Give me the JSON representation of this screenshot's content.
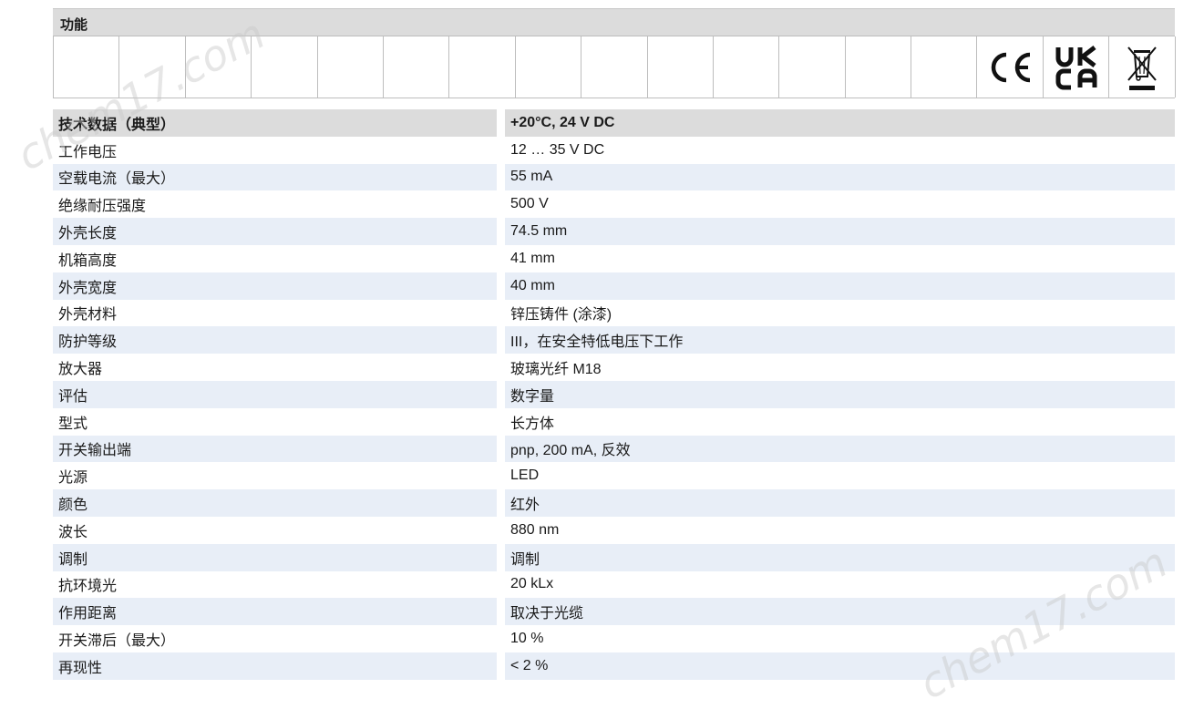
{
  "functions": {
    "title": "功能",
    "marks": [
      "CE",
      "UKCA",
      "WEEE"
    ],
    "ukca_top": "UK",
    "ukca_bottom": "CA"
  },
  "technical": {
    "header": {
      "label": "技术数据（典型）",
      "value": "+20°C, 24 V DC"
    },
    "rows": [
      {
        "label": "工作电压",
        "value": "12 … 35 V DC"
      },
      {
        "label": "空载电流（最大）",
        "value": "55 mA"
      },
      {
        "label": "绝缘耐压强度",
        "value": "500 V"
      },
      {
        "label": "外壳长度",
        "value": "74.5 mm"
      },
      {
        "label": "机箱高度",
        "value": "41 mm"
      },
      {
        "label": "外壳宽度",
        "value": "40 mm"
      },
      {
        "label": "外壳材料",
        "value": "锌压铸件 (涂漆)"
      },
      {
        "label": "防护等级",
        "value": "III，在安全特低电压下工作"
      },
      {
        "label": "放大器",
        "value": "玻璃光纤 M18"
      },
      {
        "label": "评估",
        "value": "数字量"
      },
      {
        "label": "型式",
        "value": "长方体"
      },
      {
        "label": "开关输出端",
        "value": "pnp, 200 mA, 反效"
      },
      {
        "label": "光源",
        "value": "LED"
      },
      {
        "label": "颜色",
        "value": "红外"
      },
      {
        "label": "波长",
        "value": "880 nm"
      },
      {
        "label": "调制",
        "value": "调制"
      },
      {
        "label": "抗环境光",
        "value": "20 kLx"
      },
      {
        "label": "作用距离",
        "value": "取决于光缆"
      },
      {
        "label": "开关滞后（最大）",
        "value": "10 %"
      },
      {
        "label": "再现性",
        "value": "< 2 %"
      }
    ]
  },
  "watermark": "chem17.com",
  "colors": {
    "header_bg": "#dcdcdc",
    "row_shade": "#e8eef7",
    "border": "#bdbdbd"
  }
}
